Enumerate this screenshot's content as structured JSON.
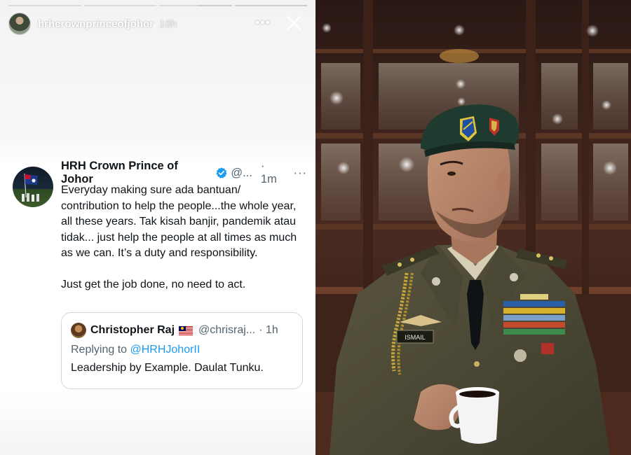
{
  "story": {
    "username": "hrhcrownprinceofjohor",
    "time_ago": "16h",
    "more_icon": "more-horizontal-icon",
    "close_icon": "close-icon",
    "progress_segments": [
      1,
      1,
      0.55,
      0
    ]
  },
  "tweet": {
    "author_name": "HRH Crown Prince of Johor",
    "handle": "@...",
    "time": "· 1m",
    "more": "···",
    "verified_color": "#1d9bf0",
    "paragraphs": [
      "Everyday making sure ada bantuan/ contribution to help the people...the whole year, all these years. Tak kisah banjir, pandemik atau tidak... just help the people at all times as much as we can. It’s a duty and responsibility.",
      "Just get the job done, no need to act."
    ],
    "quote": {
      "author_name": "Christopher Raj",
      "flag": "malaysia-flag-icon",
      "handle": "@chrisraj...",
      "time": "· 1h",
      "replying_prefix": "Replying to",
      "replying_to": "@HRHJohorII",
      "text": "Leadership by Example. Daulat Tunku."
    }
  },
  "photo": {
    "name_tag": "ISMAIL"
  },
  "colors": {
    "link": "#1d9bf0",
    "secondary_text": "#536471",
    "primary_text": "#0f1419",
    "uniform": "#4b4a36",
    "beret": "#1f3b30"
  }
}
